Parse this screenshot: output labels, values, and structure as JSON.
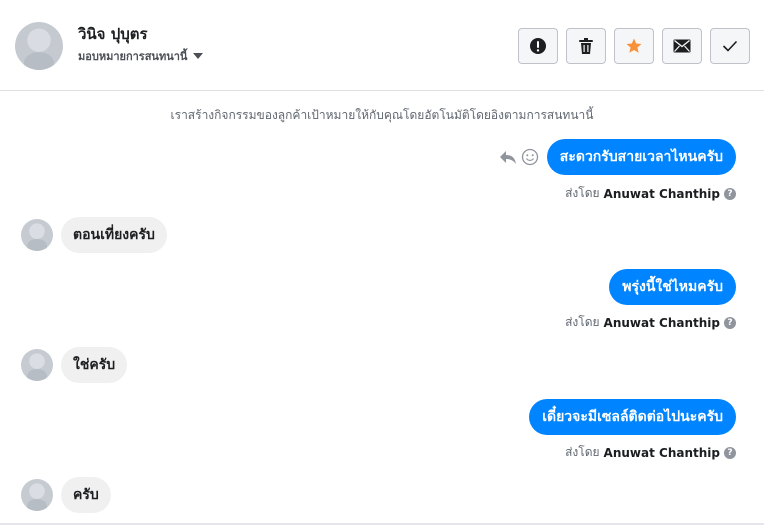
{
  "header": {
    "contact_name": "วินิจ ปุบุตร",
    "assign_label": "มอบหมายการสนทนานี้",
    "actions": [
      {
        "name": "mark-spam-button",
        "icon": "exclamation-circle-icon"
      },
      {
        "name": "delete-button",
        "icon": "trash-icon"
      },
      {
        "name": "star-button",
        "icon": "star-icon",
        "color": "#f7923b"
      },
      {
        "name": "mark-unread-button",
        "icon": "envelope-icon"
      },
      {
        "name": "mark-done-button",
        "icon": "checkmark-icon"
      }
    ]
  },
  "notice": "เราสร้างกิจกรรมของลูกค้าเป้าหมายให้กับคุณโดยอัตโนมัติโดยอิงตามการสนทนานี้",
  "messages": [
    {
      "direction": "out",
      "text": "สะดวกรับสายเวลาไหนครับ",
      "sent_by_prefix": "ส่งโดย",
      "agent": "Anuwat Chanthip"
    },
    {
      "direction": "in",
      "text": "ตอนเที่ยงครับ"
    },
    {
      "direction": "out",
      "text": "พรุ่งนี้ใช่ไหมครับ",
      "sent_by_prefix": "ส่งโดย",
      "agent": "Anuwat Chanthip"
    },
    {
      "direction": "in",
      "text": "ใช่ครับ"
    },
    {
      "direction": "out",
      "text": "เดี๋ยวจะมีเซลล์ติดต่อไปนะครับ",
      "sent_by_prefix": "ส่งโดย",
      "agent": "Anuwat Chanthip"
    },
    {
      "direction": "in",
      "text": "ครับ"
    }
  ],
  "colors": {
    "outgoing_bubble": "#0084ff",
    "incoming_bubble": "#f1f0f0",
    "star": "#f7923b"
  }
}
